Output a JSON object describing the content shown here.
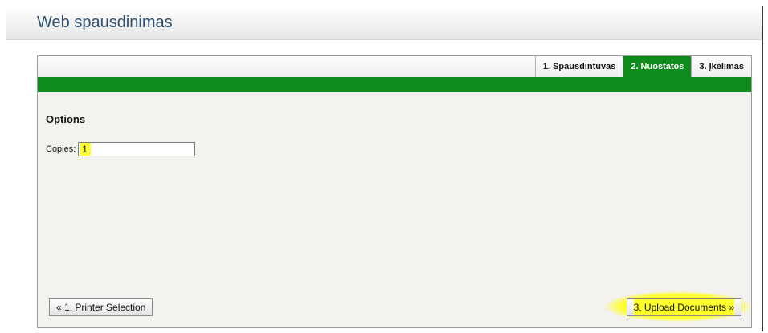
{
  "header": {
    "title": "Web spausdinimas"
  },
  "tabs": [
    {
      "label": "1. Spausdintuvas",
      "active": false
    },
    {
      "label": "2. Nuostatos",
      "active": true
    },
    {
      "label": "3. Įkėlimas",
      "active": false
    }
  ],
  "options": {
    "title": "Options",
    "copies_label": "Copies:",
    "copies_value": "1"
  },
  "buttons": {
    "prev_label": "« 1. Printer Selection",
    "next_label": "3. Upload Documents »"
  },
  "colors": {
    "accent_green": "#0f8a1c",
    "highlight_yellow": "#ffff33",
    "title_blue": "#2f4f6f"
  }
}
